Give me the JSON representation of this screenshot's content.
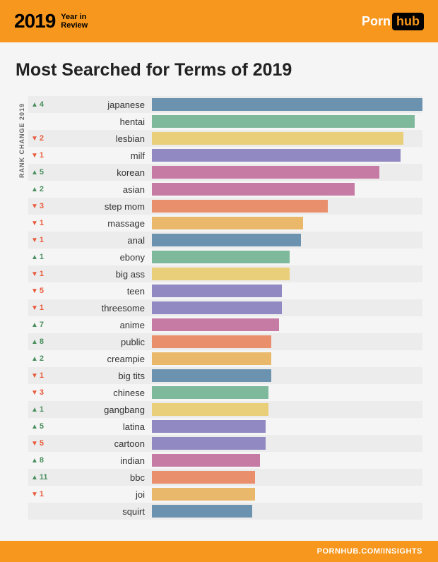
{
  "header": {
    "year": "2019",
    "year_sub1": "Year in",
    "year_sub2": "Review",
    "logo_porn": "Porn",
    "logo_hub": "hub"
  },
  "title": "Most Searched for Terms of 2019",
  "rank_axis_label": "RANK CHANGE 2019",
  "chart_data": {
    "type": "bar",
    "title": "Most Searched for Terms of 2019",
    "xlabel": "",
    "ylabel": "RANK CHANGE 2019",
    "categories": [
      "japanese",
      "hentai",
      "lesbian",
      "milf",
      "korean",
      "asian",
      "step mom",
      "massage",
      "anal",
      "ebony",
      "big ass",
      "teen",
      "threesome",
      "anime",
      "public",
      "creampie",
      "big tits",
      "chinese",
      "gangbang",
      "latina",
      "cartoon",
      "indian",
      "bbc",
      "joi",
      "squirt"
    ],
    "series": [
      {
        "name": "bar_length_pct",
        "values": [
          100,
          97,
          93,
          92,
          84,
          75,
          65,
          56,
          55,
          51,
          51,
          48,
          48,
          47,
          44,
          44,
          44,
          43,
          43,
          42,
          42,
          40,
          38,
          38,
          37
        ]
      },
      {
        "name": "rank_change",
        "values": [
          4,
          0,
          -2,
          -1,
          5,
          2,
          -3,
          -1,
          -1,
          1,
          -1,
          -5,
          -1,
          7,
          8,
          2,
          -1,
          -3,
          1,
          5,
          -5,
          8,
          11,
          -1,
          0
        ]
      }
    ],
    "colors": [
      "#6b93b0",
      "#7db99a",
      "#e9cf7a",
      "#9189c1",
      "#c67ba4",
      "#e98f6b",
      "#e9b86b"
    ],
    "rows": [
      {
        "term": "japanese",
        "dir": "up",
        "delta": "4",
        "pct": 100,
        "color": "#6b93b0"
      },
      {
        "term": "hentai",
        "dir": "",
        "delta": "",
        "pct": 97,
        "color": "#7db99a"
      },
      {
        "term": "lesbian",
        "dir": "down",
        "delta": "2",
        "pct": 93,
        "color": "#e9cf7a"
      },
      {
        "term": "milf",
        "dir": "down",
        "delta": "1",
        "pct": 92,
        "color": "#9189c1"
      },
      {
        "term": "korean",
        "dir": "up",
        "delta": "5",
        "pct": 84,
        "color": "#c67ba4"
      },
      {
        "term": "asian",
        "dir": "up",
        "delta": "2",
        "pct": 75,
        "color": "#c67ba4"
      },
      {
        "term": "step mom",
        "dir": "down",
        "delta": "3",
        "pct": 65,
        "color": "#e98f6b"
      },
      {
        "term": "massage",
        "dir": "down",
        "delta": "1",
        "pct": 56,
        "color": "#e9b86b"
      },
      {
        "term": "anal",
        "dir": "down",
        "delta": "1",
        "pct": 55,
        "color": "#6b93b0"
      },
      {
        "term": "ebony",
        "dir": "up",
        "delta": "1",
        "pct": 51,
        "color": "#7db99a"
      },
      {
        "term": "big ass",
        "dir": "down",
        "delta": "1",
        "pct": 51,
        "color": "#e9cf7a"
      },
      {
        "term": "teen",
        "dir": "down",
        "delta": "5",
        "pct": 48,
        "color": "#9189c1"
      },
      {
        "term": "threesome",
        "dir": "down",
        "delta": "1",
        "pct": 48,
        "color": "#9189c1"
      },
      {
        "term": "anime",
        "dir": "up",
        "delta": "7",
        "pct": 47,
        "color": "#c67ba4"
      },
      {
        "term": "public",
        "dir": "up",
        "delta": "8",
        "pct": 44,
        "color": "#e98f6b"
      },
      {
        "term": "creampie",
        "dir": "up",
        "delta": "2",
        "pct": 44,
        "color": "#e9b86b"
      },
      {
        "term": "big tits",
        "dir": "down",
        "delta": "1",
        "pct": 44,
        "color": "#6b93b0"
      },
      {
        "term": "chinese",
        "dir": "down",
        "delta": "3",
        "pct": 43,
        "color": "#7db99a"
      },
      {
        "term": "gangbang",
        "dir": "up",
        "delta": "1",
        "pct": 43,
        "color": "#e9cf7a"
      },
      {
        "term": "latina",
        "dir": "up",
        "delta": "5",
        "pct": 42,
        "color": "#9189c1"
      },
      {
        "term": "cartoon",
        "dir": "down",
        "delta": "5",
        "pct": 42,
        "color": "#9189c1"
      },
      {
        "term": "indian",
        "dir": "up",
        "delta": "8",
        "pct": 40,
        "color": "#c67ba4"
      },
      {
        "term": "bbc",
        "dir": "up",
        "delta": "11",
        "pct": 38,
        "color": "#e98f6b"
      },
      {
        "term": "joi",
        "dir": "down",
        "delta": "1",
        "pct": 38,
        "color": "#e9b86b"
      },
      {
        "term": "squirt",
        "dir": "",
        "delta": "",
        "pct": 37,
        "color": "#6b93b0"
      }
    ]
  },
  "footer": "PORNHUB.COM/INSIGHTS"
}
